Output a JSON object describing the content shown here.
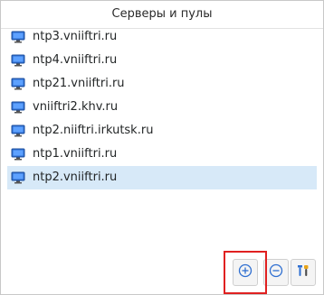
{
  "header": {
    "title": "Серверы и пулы"
  },
  "servers": [
    {
      "label": "ntp3.vniiftri.ru",
      "icon": "monitor-icon",
      "selected": false
    },
    {
      "label": "ntp4.vniiftri.ru",
      "icon": "monitor-icon",
      "selected": false
    },
    {
      "label": "ntp21.vniiftri.ru",
      "icon": "monitor-icon",
      "selected": false
    },
    {
      "label": "vniiftri2.khv.ru",
      "icon": "monitor-icon",
      "selected": false
    },
    {
      "label": "ntp2.niiftri.irkutsk.ru",
      "icon": "monitor-icon",
      "selected": false
    },
    {
      "label": "ntp1.vniiftri.ru",
      "icon": "monitor-icon",
      "selected": false
    },
    {
      "label": "ntp2.vniiftri.ru",
      "icon": "monitor-icon",
      "selected": true
    }
  ],
  "toolbar": {
    "add_icon": "add-icon",
    "remove_icon": "remove-icon",
    "configure_icon": "configure-icon"
  },
  "colors": {
    "selection": "#d7e9f8",
    "highlight": "#e02020",
    "icon_accent": "#2f6fd1"
  }
}
